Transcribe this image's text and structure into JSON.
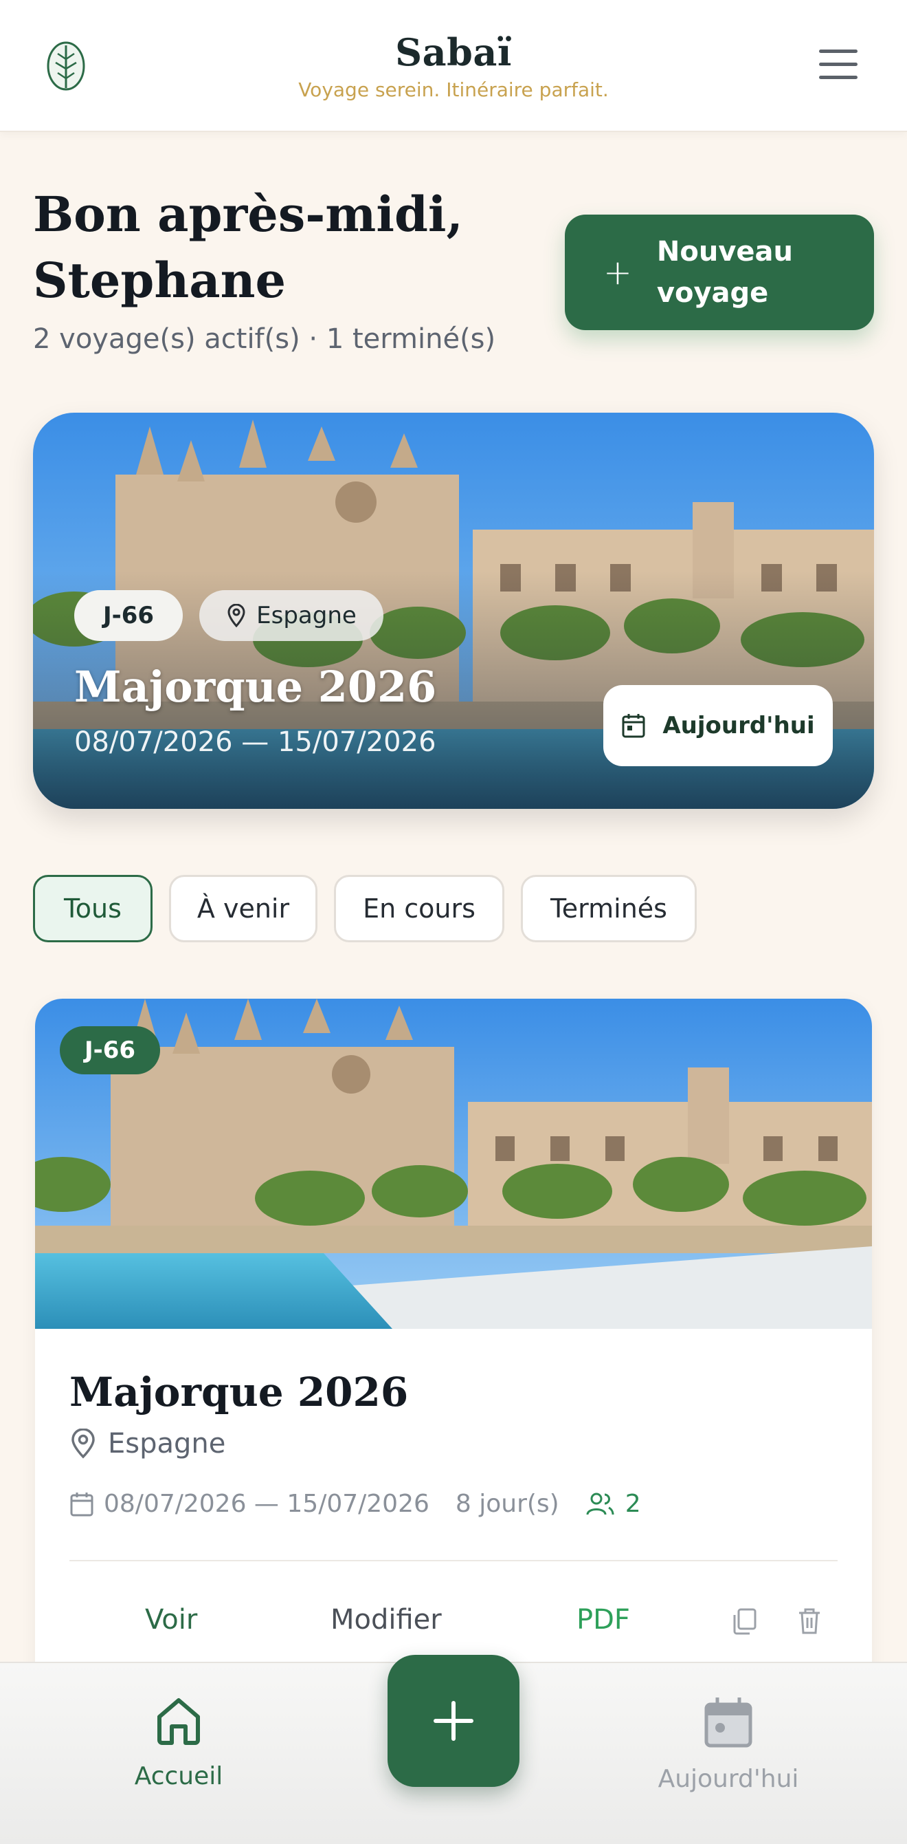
{
  "header": {
    "title": "Sabaï",
    "tagline": "Voyage serein. Itinéraire parfait.",
    "logo_icon": "leaf-icon",
    "menu_icon": "hamburger-menu-icon"
  },
  "greeting": {
    "title": "Bon après-midi, Stephane",
    "summary": "2 voyage(s) actif(s) · 1 terminé(s)"
  },
  "new_trip_button": {
    "label": "Nouveau voyage",
    "icon": "plus-icon"
  },
  "hero": {
    "countdown": "J-66",
    "country": "Espagne",
    "title": "Majorque 2026",
    "dates": "08/07/2026 — 15/07/2026",
    "today_button": "Aujourd'hui"
  },
  "filters": [
    {
      "label": "Tous",
      "active": true
    },
    {
      "label": "À venir",
      "active": false
    },
    {
      "label": "En cours",
      "active": false
    },
    {
      "label": "Terminés",
      "active": false
    }
  ],
  "trip_card": {
    "countdown": "J-66",
    "title": "Majorque 2026",
    "country": "Espagne",
    "dates": "08/07/2026 — 15/07/2026",
    "days": "8 jour(s)",
    "travelers": "2",
    "actions": {
      "view": "Voir",
      "edit": "Modifier",
      "pdf": "PDF"
    }
  },
  "bottom_nav": {
    "home": "Accueil",
    "today": "Aujourd'hui"
  },
  "colors": {
    "primary": "#2c6b47",
    "accent_gold": "#c8a24f",
    "background": "#fbf5ee",
    "pdf_green": "#2ea05a"
  }
}
